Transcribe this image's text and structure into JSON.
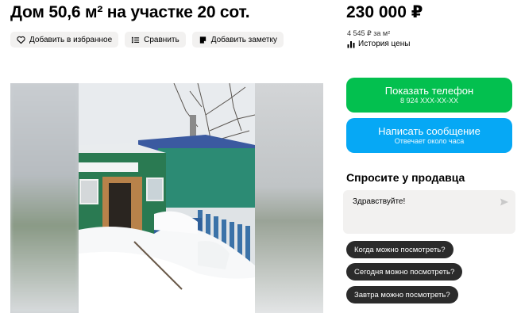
{
  "listing": {
    "title": "Дом 50,6 м² на участке 20 сот.",
    "price": "230 000 ₽",
    "price_per_m2": "4 545 ₽ за м²",
    "price_history": "История цены"
  },
  "actions": {
    "favorite": "Добавить в избранное",
    "compare": "Сравнить",
    "note": "Добавить заметку"
  },
  "contact": {
    "phone_label": "Показать телефон",
    "phone_number": "8 924 XXX-XX-XX",
    "message_label": "Написать сообщение",
    "message_sub": "Отвечает около часа"
  },
  "ask": {
    "title": "Спросите у продавца",
    "message_value": "Здравствуйте!",
    "suggestions": [
      "Когда можно посмотреть?",
      "Сегодня можно посмотреть?",
      "Завтра можно посмотреть?"
    ]
  },
  "colors": {
    "phone_button": "#03c04f",
    "message_button": "#06a8f5",
    "chip_background": "#2b2b2b"
  },
  "icons": {
    "favorite": "heart-icon",
    "compare": "compare-list-icon",
    "note": "note-icon",
    "history": "bar-chart-icon",
    "send": "send-icon"
  }
}
